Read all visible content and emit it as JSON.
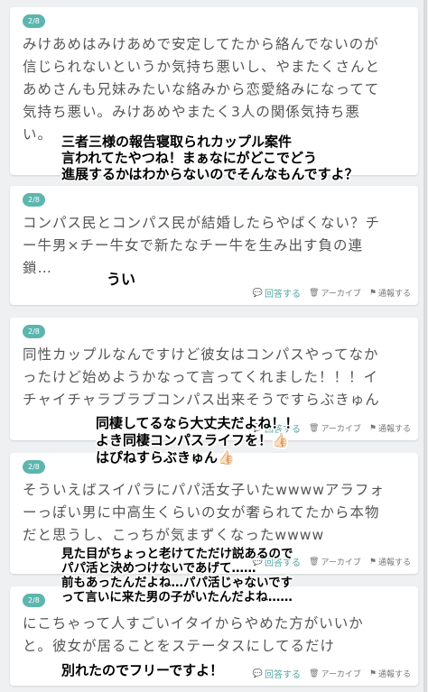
{
  "posts": [
    {
      "badge": "2/8",
      "lines": [
        "みけあめはみけあめで安定してたから絡んでないのが",
        "信じられないというか気持ち悪いし、やまたくさんと",
        "あめさんも兄妹みたいな絡みから恋愛絡みになってて",
        "気持ち悪い。みけあめやまたく3人の関係気持ち悪",
        "い。"
      ]
    },
    {
      "badge": "2/8",
      "lines": [
        "コンパス民とコンパス民が結婚したらやばくない？チ",
        "ー牛男×チー牛女で新たなチー牛を生み出す負の連",
        "鎖…"
      ]
    },
    {
      "badge": "2/8",
      "lines": [
        "同性カップルなんですけど彼女はコンパスやってなか",
        "ったけど始めようかなって言ってくれました！！！イ",
        "チャイチャラブラブコンパス出来そうですらぶきゅん"
      ]
    },
    {
      "badge": "2/8",
      "lines": [
        "そういえばスイパラにパパ活女子いたwwwwアラフォ",
        "ーっぽい男に中高生くらいの女が奢られてたから本物",
        "だと思うし、こっちが気まずくなったwwww"
      ]
    },
    {
      "badge": "2/8",
      "lines": [
        "にこちゃって人すごいイタイからやめた方がいいか",
        "と。彼女が居ることをステータスにしてるだけ"
      ]
    }
  ],
  "actions": {
    "answer": "回答する",
    "archive": "アーカイブ",
    "report": "通報する"
  },
  "overlays": [
    [
      "三者三様の報告寝取られカップル案件",
      "言われてたやつね！まぁなにがどこでどう",
      "進展するかはわからないのでそんなもんですよ？"
    ],
    [
      "うい"
    ],
    [
      "同棲してるなら大丈夫だよね！！",
      "よき同棲コンパスライフを！👍🏻",
      "はぴねすらぶきゅん👍🏻"
    ],
    [
      "見た目がちょっと老けてただけ説あるので",
      "パパ活と決めつけないであげて……",
      "前もあったんだよね…パパ活じゃないです",
      "って言いに来た男の子がいたんだよね……"
    ],
    [
      "別れたのでフリーですよ！"
    ]
  ],
  "icons": {
    "answer": "chat-bubble-icon",
    "archive": "trash-icon",
    "report": "flag-icon"
  },
  "accent_color": "#5db6ae"
}
